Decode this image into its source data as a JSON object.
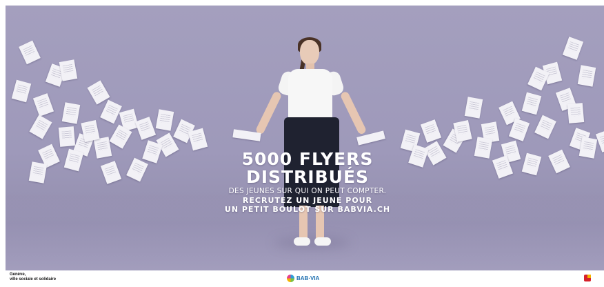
{
  "headline": {
    "line1": "5000 FLYERS",
    "line2": "DISTRIBUÉS",
    "subline": "DES JEUNES SUR QUI ON PEUT COMPTER.",
    "cta_line1": "RECRUTEZ UN JEUNE POUR",
    "cta_line2": "UN PETIT BOULOT SUR BABVIA.CH"
  },
  "footer": {
    "geneve_line1": "Genève,",
    "geneve_line2": "ville sociale et solidaire",
    "babvia_logo": "BAB·VIA"
  },
  "colors": {
    "background": "#a49fbe",
    "text": "#ffffff",
    "babvia_blue": "#1e6fb0",
    "logo_red": "#d6202a"
  }
}
